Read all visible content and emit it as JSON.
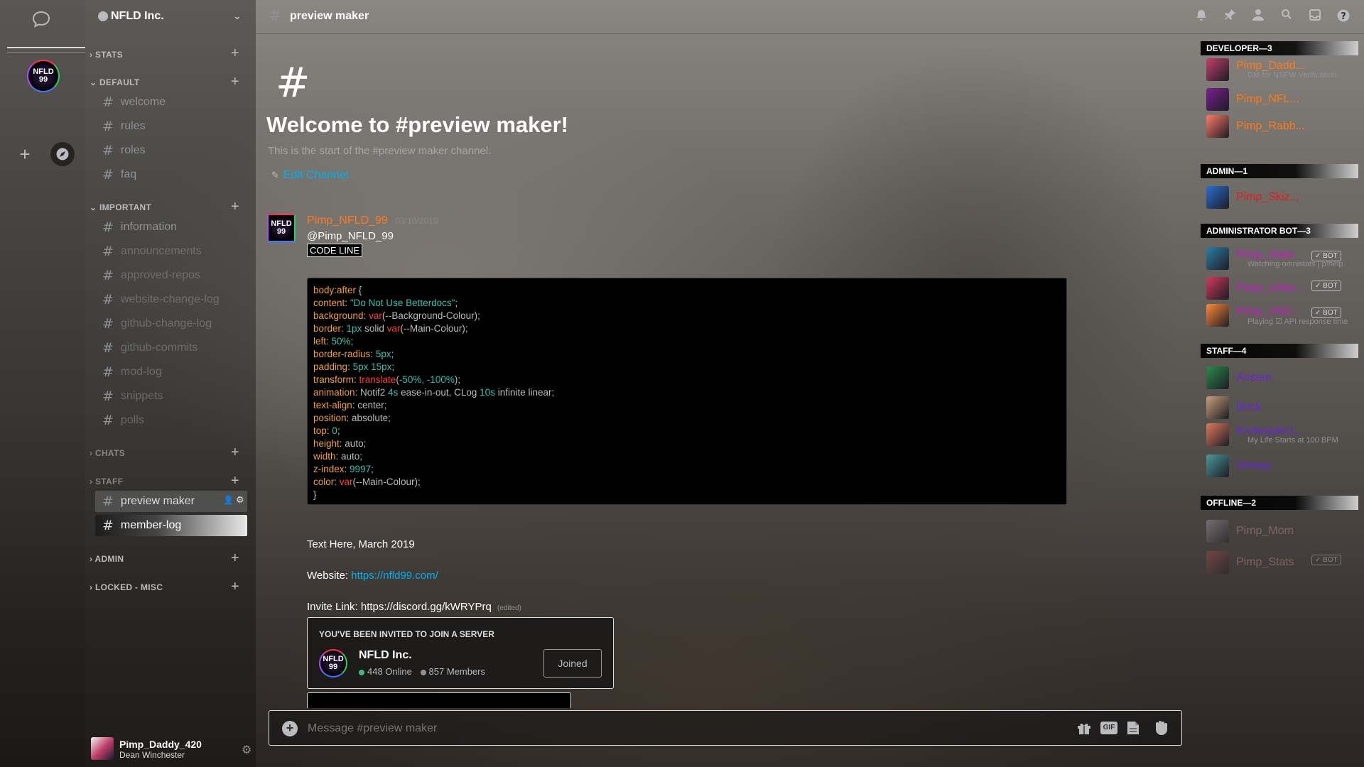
{
  "server": {
    "name": "NFLD Inc.",
    "icon_text": "NFLD 99"
  },
  "categories": [
    {
      "label": "STATS"
    },
    {
      "label": "DEFAULT"
    },
    {
      "label": "IMPORTANT"
    },
    {
      "label": "CHATS"
    },
    {
      "label": "STAFF"
    },
    {
      "label": "ADMIN"
    },
    {
      "label": "LOCKED - MISC"
    }
  ],
  "channels": {
    "default": [
      "welcome",
      "rules",
      "roles",
      "faq"
    ],
    "important": [
      "information",
      "announcements",
      "approved-repos",
      "website-change-log",
      "github-change-log",
      "github-commits",
      "mod-log",
      "snippets",
      "polls"
    ],
    "staff": [
      "preview maker",
      "member-log"
    ]
  },
  "header": {
    "channel": "preview maker"
  },
  "welcome": {
    "hash": "#",
    "title": "Welcome to #preview maker!",
    "subtitle": "This is the start of the #preview maker channel.",
    "edit": "Edit Channel"
  },
  "message": {
    "author": "Pimp_NFLD_99",
    "date": "03/10/2019",
    "mention": "@Pimp_NFLD_99",
    "code_label": "CODE LINE",
    "code": [
      [
        [
          "k",
          "body"
        ],
        [
          "k",
          ":after"
        ],
        [
          "v",
          " {"
        ]
      ],
      [
        [
          "k",
          "content"
        ],
        [
          "v",
          ": "
        ],
        [
          "s",
          "\"Do Not Use Betterdocs\""
        ],
        [
          "v",
          ";"
        ]
      ],
      [
        [
          "k",
          "background"
        ],
        [
          "v",
          ": "
        ],
        [
          "f",
          "var"
        ],
        [
          "v",
          "(--Background-Colour);"
        ]
      ],
      [
        [
          "k",
          "border"
        ],
        [
          "v",
          ": "
        ],
        [
          "n",
          "1px"
        ],
        [
          "v",
          " solid "
        ],
        [
          "f",
          "var"
        ],
        [
          "v",
          "(--Main-Colour);"
        ]
      ],
      [
        [
          "k",
          "left"
        ],
        [
          "v",
          ": "
        ],
        [
          "n",
          "50%"
        ],
        [
          "v",
          ";"
        ]
      ],
      [
        [
          "k",
          "border-radius"
        ],
        [
          "v",
          ": "
        ],
        [
          "n",
          "5px"
        ],
        [
          "v",
          ";"
        ]
      ],
      [
        [
          "k",
          "padding"
        ],
        [
          "v",
          ": "
        ],
        [
          "n",
          "5px 15px"
        ],
        [
          "v",
          ";"
        ]
      ],
      [
        [
          "k",
          "transform"
        ],
        [
          "v",
          ": "
        ],
        [
          "f",
          "translate"
        ],
        [
          "v",
          "("
        ],
        [
          "n",
          "-50%, -100%"
        ],
        [
          "v",
          ");"
        ]
      ],
      [
        [
          "k",
          "animation"
        ],
        [
          "v",
          ": Notif2 "
        ],
        [
          "n",
          "4s"
        ],
        [
          "v",
          " ease-in-out, CLog "
        ],
        [
          "n",
          "10s"
        ],
        [
          "v",
          " infinite linear;"
        ]
      ],
      [
        [
          "k",
          "text-align"
        ],
        [
          "v",
          ": center;"
        ]
      ],
      [
        [
          "k",
          "position"
        ],
        [
          "v",
          ": absolute;"
        ]
      ],
      [
        [
          "k",
          "top"
        ],
        [
          "v",
          ": "
        ],
        [
          "n",
          "0"
        ],
        [
          "v",
          ";"
        ]
      ],
      [
        [
          "k",
          "height"
        ],
        [
          "v",
          ": auto;"
        ]
      ],
      [
        [
          "k",
          "width"
        ],
        [
          "v",
          ": auto;"
        ]
      ],
      [
        [
          "k",
          "z-index"
        ],
        [
          "v",
          ": "
        ],
        [
          "n",
          "9997"
        ],
        [
          "v",
          ";"
        ]
      ],
      [
        [
          "k",
          "color"
        ],
        [
          "v",
          ": "
        ],
        [
          "f",
          "var"
        ],
        [
          "v",
          "(--Main-Colour);"
        ]
      ],
      [
        [
          "v",
          "}"
        ]
      ]
    ],
    "text_line": "Text Here, March 2019",
    "website_label": "Website: ",
    "website_url": "https://nfld99.com/",
    "invite_label": "Invite Link: https://discord.gg/kWRYPrq",
    "edited": "(edited)"
  },
  "invite": {
    "heading": "YOU'VE BEEN INVITED TO JOIN A SERVER",
    "server": "NFLD Inc.",
    "online": "448 Online",
    "members": "857 Members",
    "button": "Joined"
  },
  "composer": {
    "placeholder": "Message #preview maker"
  },
  "user": {
    "name": "Pimp_Daddy_420",
    "status": "Dean Winchester"
  },
  "members": [
    {
      "group": "DEVELOPER—3",
      "items": [
        {
          "name": "Pimp_Dadd...",
          "color": "#ff7a1a",
          "status": "DM for NSFW Verification",
          "bot": false
        },
        {
          "name": "Pimp_NFL...",
          "color": "#ff7a1a",
          "status": "",
          "bot": false
        },
        {
          "name": "Pimp_Rabb...",
          "color": "#ff7a1a",
          "status": "",
          "bot": false
        }
      ]
    },
    {
      "group": "ADMIN—1",
      "items": [
        {
          "name": "Pimp_Skiz...",
          "color": "#e0201c",
          "status": "",
          "bot": false
        }
      ]
    },
    {
      "group": "ADMINISTRATOR BOT—3",
      "items": [
        {
          "name": "Pimp_Stats",
          "color": "#c21ec2",
          "status": "Watching omnistats | p!help",
          "bot": true
        },
        {
          "name": "Pimp_Unbo...",
          "color": "#c21ec2",
          "status": "",
          "bot": true
        },
        {
          "name": "Pimp_YAG...",
          "color": "#c21ec2",
          "status": "Playing ☑ API response time",
          "bot": true
        }
      ]
    },
    {
      "group": "STAFF—4",
      "items": [
        {
          "name": "Ansem",
          "color": "#6a24d6",
          "status": "",
          "bot": false
        },
        {
          "name": "Brick",
          "color": "#6a24d6",
          "status": "",
          "bot": false
        },
        {
          "name": "Krokeyyks1...",
          "color": "#6a24d6",
          "status": "My Life Starts at 100 BPM",
          "bot": false
        },
        {
          "name": "Sleepy",
          "color": "#6a24d6",
          "status": "",
          "bot": false
        }
      ]
    },
    {
      "group": "OFFLINE—2",
      "items": [
        {
          "name": "Pimp_Mom",
          "color": "#c89098",
          "status": "",
          "bot": false
        },
        {
          "name": "Pimp_Stats",
          "color": "#c89098",
          "status": "",
          "bot": true
        }
      ]
    }
  ],
  "labels": {
    "bot": "✓ BOT"
  },
  "colors": {
    "link": "#00b0f4",
    "author": "#ff7a1a",
    "online": "#43b581"
  }
}
